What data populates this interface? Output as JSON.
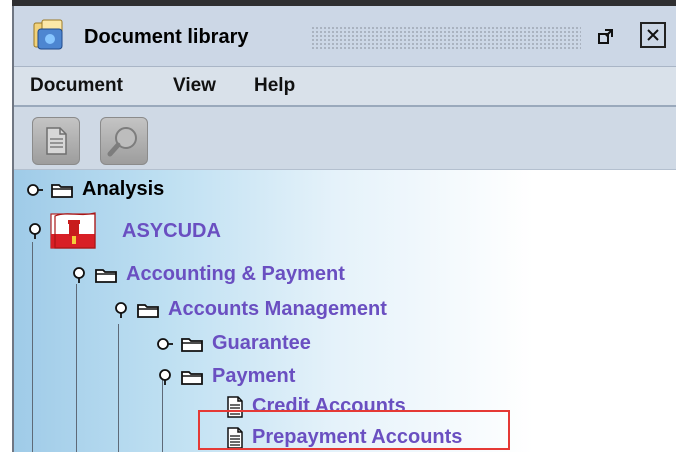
{
  "window": {
    "title": "Document library",
    "icon": "document-library-icon",
    "buttons": [
      "restore-icon",
      "close-icon"
    ]
  },
  "menu": [
    {
      "label": "Document"
    },
    {
      "label": "View"
    },
    {
      "label": "Help"
    }
  ],
  "toolbar": {
    "buttons": [
      {
        "icon": "document-icon"
      },
      {
        "icon": "magnifier-icon"
      }
    ]
  },
  "tree": {
    "nodes": [
      {
        "label": "Analysis",
        "state": "collapsed"
      },
      {
        "label": "ASYCUDA",
        "state": "expanded",
        "icon": "gibraltar-flag-icon"
      },
      {
        "label": "Accounting & Payment",
        "state": "expanded"
      },
      {
        "label": "Accounts Management",
        "state": "expanded"
      },
      {
        "label": "Guarantee",
        "state": "collapsed"
      },
      {
        "label": "Payment",
        "state": "expanded"
      },
      {
        "label": "Credit Accounts",
        "state": "leaf"
      },
      {
        "label": "Prepayment Accounts",
        "state": "leaf",
        "highlighted": true
      }
    ]
  },
  "colors": {
    "accent_purple": "#6a4fc1",
    "highlight_red": "#e53935"
  }
}
